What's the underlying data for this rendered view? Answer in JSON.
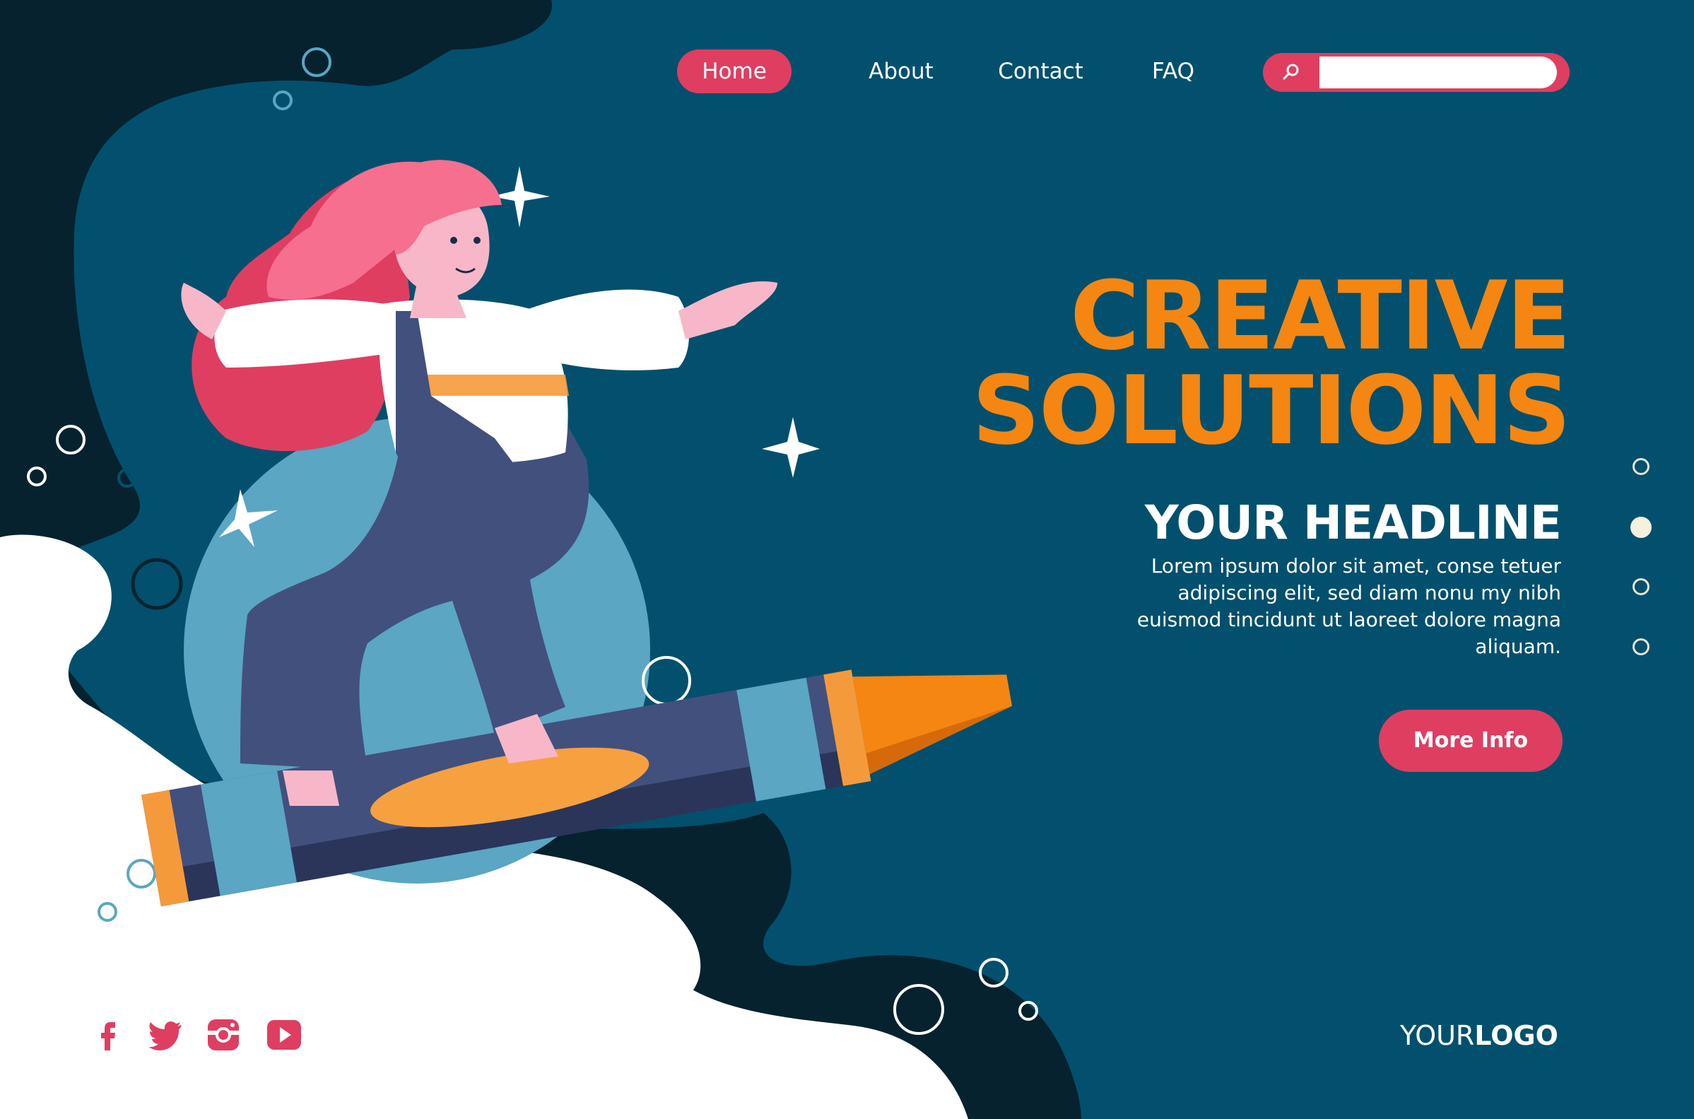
{
  "nav": {
    "items": [
      {
        "label": "Home",
        "active": true
      },
      {
        "label": "About"
      },
      {
        "label": "Contact"
      },
      {
        "label": "FAQ"
      }
    ],
    "search": {
      "icon": "search-icon",
      "value": "",
      "placeholder": ""
    }
  },
  "hero": {
    "title_line1": "CREATIVE",
    "title_line2": "SOLUTIONS",
    "headline": "YOUR HEADLINE",
    "body": "Lorem ipsum dolor sit amet, conse tetuer adipiscing elit, sed diam nonu my nibh euismod tincidunt ut laoreet dolore magna aliquam.",
    "cta_label": "More Info"
  },
  "pagination": {
    "count": 4,
    "active_index": 1
  },
  "social": [
    "facebook-icon",
    "twitter-icon",
    "instagram-icon",
    "youtube-icon"
  ],
  "logo": {
    "part1": "YOUR",
    "part2": "LOGO"
  },
  "colors": {
    "background": "#02506d",
    "dark_shape": "#06222e",
    "accent_pink": "#df3e61",
    "accent_orange": "#f58611",
    "text": "#ffffff"
  }
}
